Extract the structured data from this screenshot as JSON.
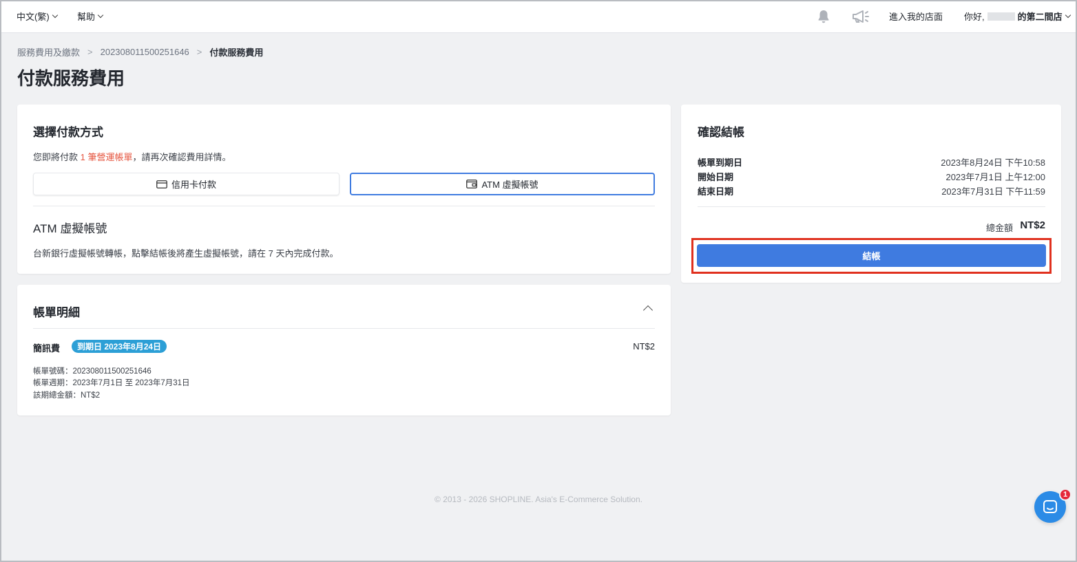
{
  "nav": {
    "language": "中文(繁)",
    "help": "幫助",
    "enter_store": "進入我的店面",
    "greeting": "你好,",
    "store_name": "的第二間店"
  },
  "breadcrumb": {
    "items": [
      "服務費用及繳款",
      "202308011500251646"
    ],
    "current": "付款服務費用"
  },
  "page_title": "付款服務費用",
  "payment": {
    "title": "選擇付款方式",
    "notice_prefix": "您即將付款",
    "notice_highlight": "1 筆營運帳單",
    "notice_suffix": "，請再次確認費用詳情。",
    "methods": [
      {
        "label": "信用卡付款",
        "icon": "credit-card-icon"
      },
      {
        "label": "ATM 虛擬帳號",
        "icon": "wallet-icon",
        "selected": true
      }
    ],
    "atm_title": "ATM 虛擬帳號",
    "atm_desc": "台新銀行虛擬帳號轉帳，點擊結帳後將產生虛擬帳號，請在 7 天內完成付款。"
  },
  "bill": {
    "title": "帳單明細",
    "fee_name": "簡訊費",
    "due_badge": "到期日 2023年8月24日",
    "amount": "NT$2",
    "bill_no": "帳單號碼：202308011500251646",
    "period": "帳單週期：2023年7月1日 至 2023年7月31日",
    "total": "該期總金額：NT$2"
  },
  "confirm": {
    "title": "確認結帳",
    "rows": [
      {
        "label": "帳單到期日",
        "value": "2023年8月24日 下午10:58"
      },
      {
        "label": "開始日期",
        "value": "2023年7月1日 上午12:00"
      },
      {
        "label": "結束日期",
        "value": "2023年7月31日 下午11:59"
      }
    ],
    "total_label": "總金額",
    "total_value": "NT$2",
    "checkout_label": "結帳"
  },
  "footer": "© 2013 - 2026 SHOPLINE. Asia's E-Commerce Solution.",
  "chat_badge": "1",
  "colors": {
    "accent": "#3f7be0",
    "highlight_text": "#e5533d",
    "badge": "#2c9fd6",
    "annotation": "#e0301e"
  }
}
